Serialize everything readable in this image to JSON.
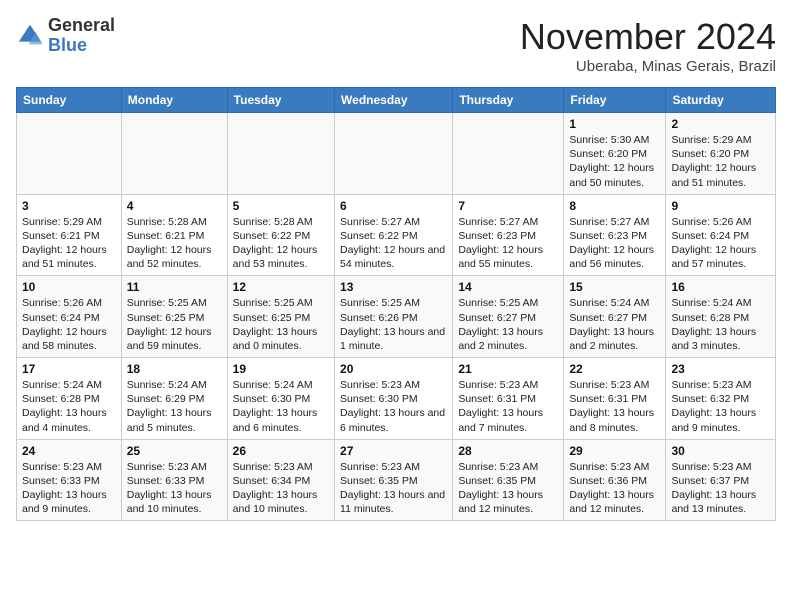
{
  "logo": {
    "general": "General",
    "blue": "Blue"
  },
  "title": "November 2024",
  "location": "Uberaba, Minas Gerais, Brazil",
  "days_of_week": [
    "Sunday",
    "Monday",
    "Tuesday",
    "Wednesday",
    "Thursday",
    "Friday",
    "Saturday"
  ],
  "weeks": [
    [
      {
        "day": "",
        "info": ""
      },
      {
        "day": "",
        "info": ""
      },
      {
        "day": "",
        "info": ""
      },
      {
        "day": "",
        "info": ""
      },
      {
        "day": "",
        "info": ""
      },
      {
        "day": "1",
        "info": "Sunrise: 5:30 AM\nSunset: 6:20 PM\nDaylight: 12 hours and 50 minutes."
      },
      {
        "day": "2",
        "info": "Sunrise: 5:29 AM\nSunset: 6:20 PM\nDaylight: 12 hours and 51 minutes."
      }
    ],
    [
      {
        "day": "3",
        "info": "Sunrise: 5:29 AM\nSunset: 6:21 PM\nDaylight: 12 hours and 51 minutes."
      },
      {
        "day": "4",
        "info": "Sunrise: 5:28 AM\nSunset: 6:21 PM\nDaylight: 12 hours and 52 minutes."
      },
      {
        "day": "5",
        "info": "Sunrise: 5:28 AM\nSunset: 6:22 PM\nDaylight: 12 hours and 53 minutes."
      },
      {
        "day": "6",
        "info": "Sunrise: 5:27 AM\nSunset: 6:22 PM\nDaylight: 12 hours and 54 minutes."
      },
      {
        "day": "7",
        "info": "Sunrise: 5:27 AM\nSunset: 6:23 PM\nDaylight: 12 hours and 55 minutes."
      },
      {
        "day": "8",
        "info": "Sunrise: 5:27 AM\nSunset: 6:23 PM\nDaylight: 12 hours and 56 minutes."
      },
      {
        "day": "9",
        "info": "Sunrise: 5:26 AM\nSunset: 6:24 PM\nDaylight: 12 hours and 57 minutes."
      }
    ],
    [
      {
        "day": "10",
        "info": "Sunrise: 5:26 AM\nSunset: 6:24 PM\nDaylight: 12 hours and 58 minutes."
      },
      {
        "day": "11",
        "info": "Sunrise: 5:25 AM\nSunset: 6:25 PM\nDaylight: 12 hours and 59 minutes."
      },
      {
        "day": "12",
        "info": "Sunrise: 5:25 AM\nSunset: 6:25 PM\nDaylight: 13 hours and 0 minutes."
      },
      {
        "day": "13",
        "info": "Sunrise: 5:25 AM\nSunset: 6:26 PM\nDaylight: 13 hours and 1 minute."
      },
      {
        "day": "14",
        "info": "Sunrise: 5:25 AM\nSunset: 6:27 PM\nDaylight: 13 hours and 2 minutes."
      },
      {
        "day": "15",
        "info": "Sunrise: 5:24 AM\nSunset: 6:27 PM\nDaylight: 13 hours and 2 minutes."
      },
      {
        "day": "16",
        "info": "Sunrise: 5:24 AM\nSunset: 6:28 PM\nDaylight: 13 hours and 3 minutes."
      }
    ],
    [
      {
        "day": "17",
        "info": "Sunrise: 5:24 AM\nSunset: 6:28 PM\nDaylight: 13 hours and 4 minutes."
      },
      {
        "day": "18",
        "info": "Sunrise: 5:24 AM\nSunset: 6:29 PM\nDaylight: 13 hours and 5 minutes."
      },
      {
        "day": "19",
        "info": "Sunrise: 5:24 AM\nSunset: 6:30 PM\nDaylight: 13 hours and 6 minutes."
      },
      {
        "day": "20",
        "info": "Sunrise: 5:23 AM\nSunset: 6:30 PM\nDaylight: 13 hours and 6 minutes."
      },
      {
        "day": "21",
        "info": "Sunrise: 5:23 AM\nSunset: 6:31 PM\nDaylight: 13 hours and 7 minutes."
      },
      {
        "day": "22",
        "info": "Sunrise: 5:23 AM\nSunset: 6:31 PM\nDaylight: 13 hours and 8 minutes."
      },
      {
        "day": "23",
        "info": "Sunrise: 5:23 AM\nSunset: 6:32 PM\nDaylight: 13 hours and 9 minutes."
      }
    ],
    [
      {
        "day": "24",
        "info": "Sunrise: 5:23 AM\nSunset: 6:33 PM\nDaylight: 13 hours and 9 minutes."
      },
      {
        "day": "25",
        "info": "Sunrise: 5:23 AM\nSunset: 6:33 PM\nDaylight: 13 hours and 10 minutes."
      },
      {
        "day": "26",
        "info": "Sunrise: 5:23 AM\nSunset: 6:34 PM\nDaylight: 13 hours and 10 minutes."
      },
      {
        "day": "27",
        "info": "Sunrise: 5:23 AM\nSunset: 6:35 PM\nDaylight: 13 hours and 11 minutes."
      },
      {
        "day": "28",
        "info": "Sunrise: 5:23 AM\nSunset: 6:35 PM\nDaylight: 13 hours and 12 minutes."
      },
      {
        "day": "29",
        "info": "Sunrise: 5:23 AM\nSunset: 6:36 PM\nDaylight: 13 hours and 12 minutes."
      },
      {
        "day": "30",
        "info": "Sunrise: 5:23 AM\nSunset: 6:37 PM\nDaylight: 13 hours and 13 minutes."
      }
    ]
  ]
}
